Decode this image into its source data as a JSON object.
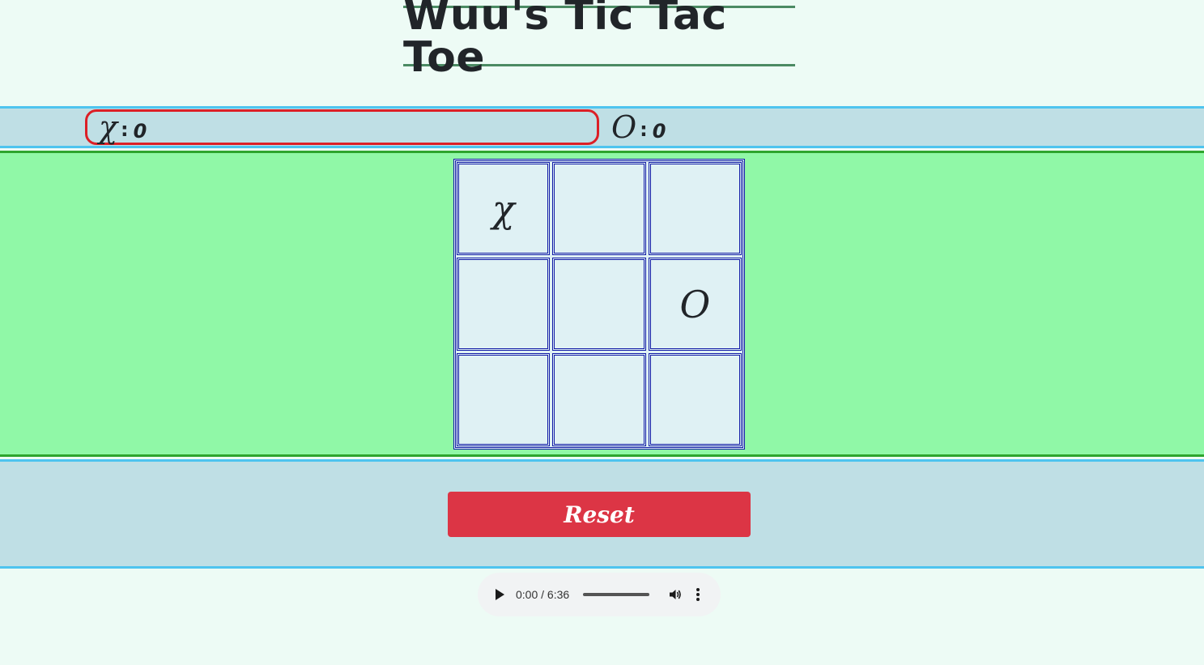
{
  "title": "Wuu's Tic Tac Toe",
  "scoreboard": {
    "x": {
      "symbol": "χ",
      "colon": ":",
      "score": "0"
    },
    "o": {
      "symbol": "O",
      "colon": ":",
      "score": "0"
    }
  },
  "board": {
    "cells": [
      "χ",
      "",
      "",
      "",
      "",
      "O",
      "",
      "",
      ""
    ]
  },
  "reset_label": "Reset",
  "audio": {
    "time": "0:00 / 6:36",
    "icons": [
      "play-icon",
      "volume-icon",
      "more-options-icon"
    ]
  },
  "colors": {
    "page_bg": "#edfbf5",
    "score_band": "#bfdfe5",
    "board_band": "#90f8a7",
    "board_border": "#111aa6",
    "active_player_border": "#dc1f26",
    "reset_button": "#dc3545"
  }
}
